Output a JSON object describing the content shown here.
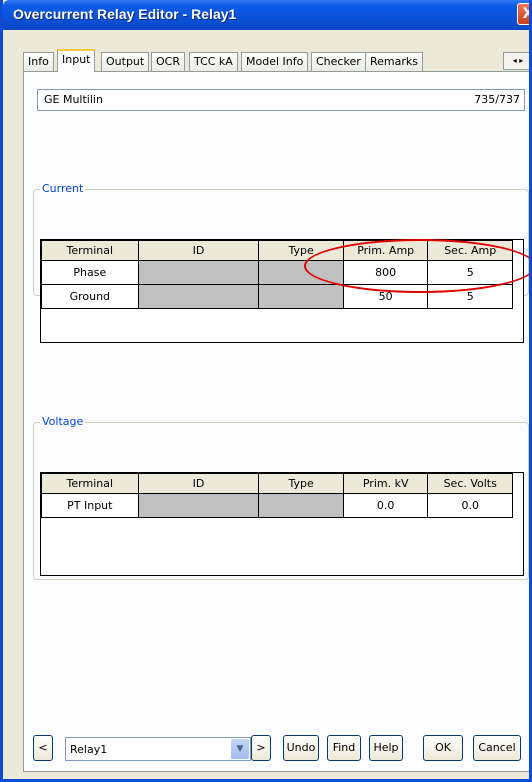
{
  "window": {
    "title": "Overcurrent Relay Editor - Relay1",
    "close_label": "X"
  },
  "tabs": [
    "Info",
    "Input",
    "Output",
    "OCR",
    "TCC kA",
    "Model Info",
    "Checker",
    "Remarks"
  ],
  "tab_scroll": "◂ ▸",
  "header": {
    "manufacturer": "GE Multilin",
    "model": "735/737"
  },
  "current": {
    "label": "Current",
    "columns": [
      "Terminal",
      "ID",
      "Type",
      "Prim. Amp",
      "Sec. Amp"
    ],
    "rows": [
      {
        "terminal": "Phase",
        "id": "",
        "type": "",
        "prim": "800",
        "sec": "5"
      },
      {
        "terminal": "Ground",
        "id": "",
        "type": "",
        "prim": "50",
        "sec": "5"
      }
    ]
  },
  "voltage": {
    "label": "Voltage",
    "columns": [
      "Terminal",
      "ID",
      "Type",
      "Prim. kV",
      "Sec. Volts"
    ],
    "rows": [
      {
        "terminal": "PT Input",
        "id": "",
        "type": "",
        "prim": "0.0",
        "sec": "0.0"
      }
    ]
  },
  "bottom": {
    "prev_label": "<",
    "relay_value": "Relay1",
    "next_label": ">",
    "undo_label": "Undo",
    "find_label": "Find",
    "help_label": "Help",
    "ok_label": "OK",
    "cancel_label": "Cancel"
  },
  "colors": {
    "title_bar": "#0a5be8",
    "highlight": "#e00000",
    "group_label": "#0046d5"
  }
}
